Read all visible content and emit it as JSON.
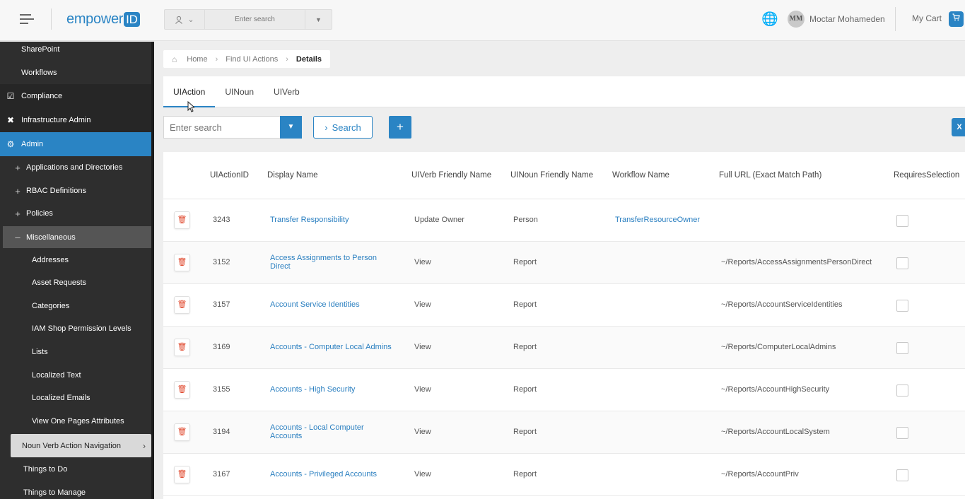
{
  "header": {
    "logo_text": "empower",
    "logo_id": "ID",
    "search_placeholder": "Enter search",
    "user_initials": "MM",
    "user_name": "Moctar Mohameden",
    "cart_label": "My Cart"
  },
  "sidebar": {
    "items": [
      {
        "label": "SharePoint"
      },
      {
        "label": "Workflows"
      },
      {
        "label": "Compliance"
      },
      {
        "label": "Infrastructure Admin"
      },
      {
        "label": "Admin"
      },
      {
        "label": "Applications and Directories"
      },
      {
        "label": "RBAC Definitions"
      },
      {
        "label": "Policies"
      },
      {
        "label": "Miscellaneous"
      },
      {
        "label": "Addresses"
      },
      {
        "label": "Asset Requests"
      },
      {
        "label": "Categories"
      },
      {
        "label": "IAM Shop Permission Levels"
      },
      {
        "label": "Lists"
      },
      {
        "label": "Localized Text"
      },
      {
        "label": "Localized Emails"
      },
      {
        "label": "View One Pages Attributes"
      },
      {
        "label": "Noun Verb Action Navigation"
      },
      {
        "label": "Things to Do"
      },
      {
        "label": "Things to Manage"
      }
    ]
  },
  "breadcrumb": {
    "home": "Home",
    "find": "Find UI Actions",
    "current": "Details"
  },
  "tabs": [
    {
      "label": "UIAction",
      "active": true
    },
    {
      "label": "UINoun",
      "active": false
    },
    {
      "label": "UIVerb",
      "active": false
    }
  ],
  "toolbar": {
    "search_placeholder": "Enter search",
    "search_label": "Search",
    "add_label": "+"
  },
  "table": {
    "columns": [
      "UIActionID",
      "Display Name",
      "UIVerb Friendly Name",
      "UINoun Friendly Name",
      "Workflow Name",
      "Full URL (Exact Match Path)",
      "RequiresSelection"
    ],
    "rows": [
      {
        "id": "3243",
        "display": "Transfer Responsibility",
        "verb": "Update Owner",
        "noun": "Person",
        "workflow": "TransferResourceOwner",
        "url": ""
      },
      {
        "id": "3152",
        "display": "Access Assignments to Person Direct",
        "verb": "View",
        "noun": "Report",
        "workflow": "",
        "url": "~/Reports/AccessAssignmentsPersonDirect"
      },
      {
        "id": "3157",
        "display": "Account Service Identities",
        "verb": "View",
        "noun": "Report",
        "workflow": "",
        "url": "~/Reports/AccountServiceIdentities"
      },
      {
        "id": "3169",
        "display": "Accounts - Computer Local Admins",
        "verb": "View",
        "noun": "Report",
        "workflow": "",
        "url": "~/Reports/ComputerLocalAdmins"
      },
      {
        "id": "3155",
        "display": "Accounts - High Security",
        "verb": "View",
        "noun": "Report",
        "workflow": "",
        "url": "~/Reports/AccountHighSecurity"
      },
      {
        "id": "3194",
        "display": "Accounts - Local Computer Accounts",
        "verb": "View",
        "noun": "Report",
        "workflow": "",
        "url": "~/Reports/AccountLocalSystem"
      },
      {
        "id": "3167",
        "display": "Accounts - Privileged Accounts",
        "verb": "View",
        "noun": "Report",
        "workflow": "",
        "url": "~/Reports/AccountPriv"
      }
    ]
  },
  "colors": {
    "accent": "#2a84c4",
    "sidebar_bg": "#2e2e2e",
    "delete_icon": "#e04a2f"
  }
}
